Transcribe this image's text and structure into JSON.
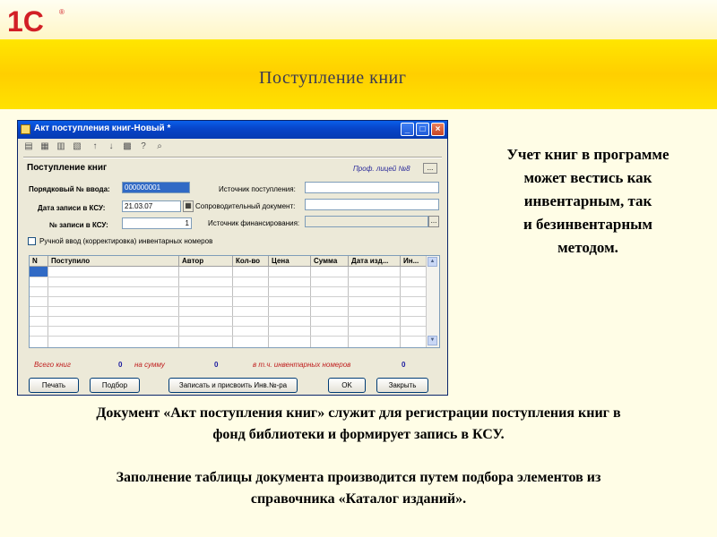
{
  "slide": {
    "logo_text": "1С",
    "logo_mark": "®",
    "title": "Поступление книг",
    "side_text": [
      "Учет книг в программе",
      "может вестись как",
      "инвентарным, так",
      "и безинвентарным",
      "методом."
    ],
    "paragraph1": [
      "Документ «Акт поступления книг» служит для регистрации поступления книг в",
      "фонд библиотеки и формирует запись в КСУ."
    ],
    "paragraph2": [
      "Заполнение таблицы документа производится путем подбора элементов из",
      "справочника «Каталог изданий»."
    ]
  },
  "window": {
    "title": "Акт поступления книг-Новый *",
    "min_label": "_",
    "max_label": "□",
    "close_label": "×",
    "toolbar_icons": [
      "▤",
      "▦",
      "▥",
      "▧",
      "↑",
      "↓",
      "▩",
      "?",
      "⌕"
    ],
    "section_title": "Поступление книг",
    "hint": "Проф. лицей №8",
    "hint_button": "...",
    "fields": {
      "order_label": "Порядковый № ввода:",
      "order_value": "000000001",
      "date_label": "Дата записи в КСУ:",
      "date_value": "21.03.07",
      "ksu_label": "№ записи в КСУ:",
      "ksu_value": "1",
      "source_label": "Источник поступления:",
      "source_value": "",
      "doc_label": "Сопроводительный документ:",
      "doc_value": "",
      "finance_label": "Источник финансирования:",
      "finance_value": "",
      "finance_button": "...",
      "calendar_icon": "▦"
    },
    "manual_checkbox_label": "Ручной ввод (корректировка) инвентарных номеров",
    "manual_checkbox_checked": false,
    "table_columns": [
      "N",
      "Поступило",
      "Автор",
      "Кол-во",
      "Цена",
      "Сумма",
      "Дата изд...",
      "Ин..."
    ],
    "totals": {
      "books_label": "Всего книг",
      "books_value": "0",
      "sum_label": "на сумму",
      "sum_value": "0",
      "inv_label": "в т.ч. инвентарных номеров",
      "inv_value": "0"
    },
    "buttons": {
      "print": "Печать",
      "select": "Подбор",
      "save_assign": "Записать и присвоить Инв.№-ра",
      "ok": "OK",
      "close": "Закрыть"
    }
  }
}
